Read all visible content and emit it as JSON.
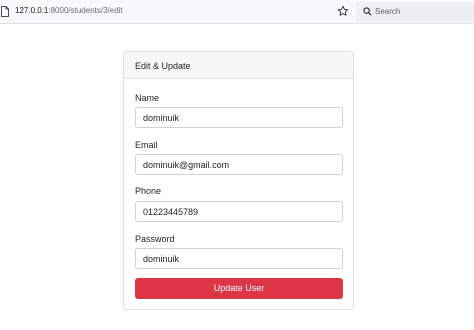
{
  "browser": {
    "url_host": "127.0.0.1",
    "url_path": ":8000/students/3/edit",
    "search_placeholder": "Search"
  },
  "card": {
    "title": "Edit & Update"
  },
  "form": {
    "fields": [
      {
        "label": "Name",
        "value": "dominuik"
      },
      {
        "label": "Email",
        "value": "dominuik@gmail.com"
      },
      {
        "label": "Phone",
        "value": "01223445789"
      },
      {
        "label": "Password",
        "value": "dominuik"
      }
    ],
    "submit_label": "Update User"
  },
  "colors": {
    "danger": "#dc3545",
    "input_border": "#ced4da",
    "card_border": "#dcdfe3",
    "card_header_bg": "#f7f7f7"
  },
  "icons": {
    "url_bar": "page-icon",
    "bookmark": "star-icon",
    "browser_search": "search-icon"
  }
}
